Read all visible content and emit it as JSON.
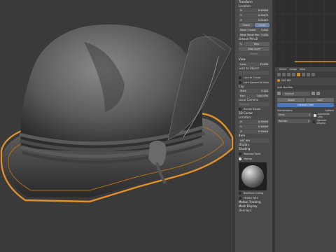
{
  "npanel": {
    "transform_header": "Transform",
    "location_label": "Location:",
    "loc": [
      {
        "axis": "X:",
        "value": "0.00000"
      },
      {
        "axis": "Y:",
        "value": "0.00479"
      },
      {
        "axis": "Z:",
        "value": "0.03127"
      }
    ],
    "global_label": "Global",
    "local_label": "Local",
    "mean_crease": {
      "label": "Mean Crease:",
      "value": "0.000"
    },
    "mean_bevel": {
      "label": "Mean Bevel Wei:",
      "value": "0.000"
    },
    "grease_pencil": "Grease Pencil",
    "new_label": "New",
    "new_layer": "New Layer",
    "delete_label": "Delete",
    "view_header": "View",
    "lens": {
      "label": "Lens:",
      "value": "35.000"
    },
    "lock_to_object": "Lock to Object:",
    "lock_to_cursor": "Lock to Cursor",
    "lock_camera": "Lock Camera to View",
    "clip_label": "Clip:",
    "clip_start": {
      "label": "Start:",
      "value": "0.100"
    },
    "clip_end": {
      "label": "End:",
      "value": "1000.000"
    },
    "local_camera": "Local Camera:",
    "camera_label": "Camera",
    "render_border": "Render Border",
    "cursor_header": "3D Cursor",
    "cursor_location": "Location:",
    "cursor": [
      {
        "axis": "X:",
        "value": "0.00000"
      },
      {
        "axis": "Y:",
        "value": "0.00000"
      },
      {
        "axis": "Z:",
        "value": "0.00000"
      }
    ],
    "item_header": "Item",
    "item_name": "HAT WH",
    "display_header": "Display",
    "shading_header": "Shading",
    "textured_solid": "Textured Solid",
    "matcap": "Matcap",
    "backface_culling": "Backface Culling",
    "hidden_wire": "Hidden Wire",
    "motion_tracking": "Motion Tracking",
    "mesh_display": "Mesh Display",
    "overlays": "Overlays:"
  },
  "graph_header": {
    "items": [
      "Select",
      "Image",
      "View"
    ]
  },
  "props": {
    "object_name": "HAT WH",
    "panel_title": "Add Modifier",
    "modifier_name": "Subsurf",
    "apply_label": "Apply",
    "copy_label": "Copy",
    "subdivision": "Catmull-Clark",
    "subdivisions_label": "Subdivisions:",
    "options_label": "Options",
    "view": {
      "label": "View:",
      "value": "1"
    },
    "render": {
      "label": "Render:",
      "value": "2"
    },
    "subdivide_uvs": "Subdivide UVs",
    "optimal_display": "Optimal Display"
  },
  "colors": {
    "selection": "#e0902a",
    "blue_button": "#4d77b8"
  },
  "icons": [
    "hat-mesh",
    "matcap-sphere",
    "object-icon",
    "modifier-icon"
  ]
}
